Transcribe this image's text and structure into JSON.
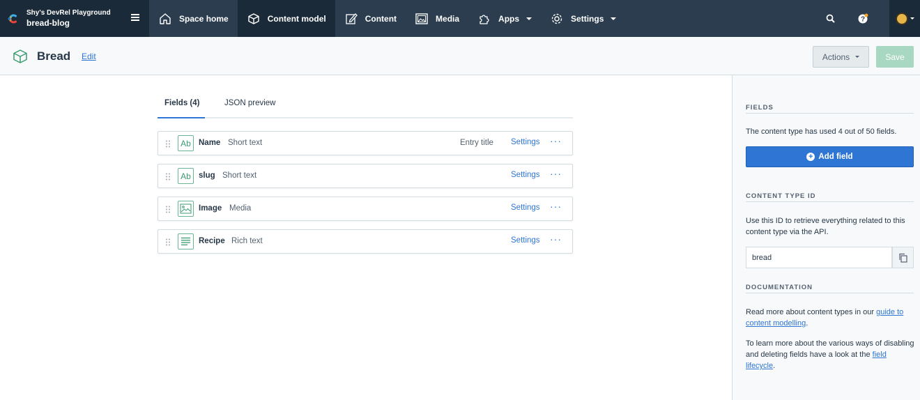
{
  "topbar": {
    "space_org": "Shy's DevRel Playground",
    "space_env": "bread-blog",
    "nav": [
      {
        "label": "Space home",
        "icon": "home-icon"
      },
      {
        "label": "Content model",
        "icon": "box-icon"
      },
      {
        "label": "Content",
        "icon": "edit-icon"
      },
      {
        "label": "Media",
        "icon": "image-icon"
      },
      {
        "label": "Apps",
        "icon": "puzzle-icon"
      },
      {
        "label": "Settings",
        "icon": "gear-icon"
      }
    ]
  },
  "header": {
    "title": "Bread",
    "edit_label": "Edit",
    "actions_label": "Actions",
    "save_label": "Save"
  },
  "tabs": [
    {
      "label": "Fields (4)"
    },
    {
      "label": "JSON preview"
    }
  ],
  "fields": [
    {
      "name": "Name",
      "type": "Short text",
      "badge": "Entry title",
      "icon": "Ab",
      "settings": "Settings",
      "more": "···"
    },
    {
      "name": "slug",
      "type": "Short text",
      "badge": "",
      "icon": "Ab",
      "settings": "Settings",
      "more": "···"
    },
    {
      "name": "Image",
      "type": "Media",
      "badge": "",
      "icon": "image",
      "settings": "Settings",
      "more": "···"
    },
    {
      "name": "Recipe",
      "type": "Rich text",
      "badge": "",
      "icon": "richtext",
      "settings": "Settings",
      "more": "···"
    }
  ],
  "sidebar": {
    "fields_heading": "FIELDS",
    "fields_text": "The content type has used 4 out of 50 fields.",
    "add_field_label": "Add field",
    "id_heading": "CONTENT TYPE ID",
    "id_text": "Use this ID to retrieve everything related to this content type via the API.",
    "id_value": "bread",
    "doc_heading": "DOCUMENTATION",
    "doc_text_1a": "Read more about content types in our ",
    "doc_link_1": "guide to content modelling",
    "doc_text_1b": ".",
    "doc_text_2a": "To learn more about the various ways of disabling and deleting fields have a look at the ",
    "doc_link_2": "field lifecycle",
    "doc_text_2b": "."
  },
  "colors": {
    "nav_bg": "#2b3d4f",
    "nav_active": "#1b2a38",
    "accent": "#2e75d4",
    "save_disabled": "#a9d8c2",
    "field_icon": "#3a9b70"
  }
}
